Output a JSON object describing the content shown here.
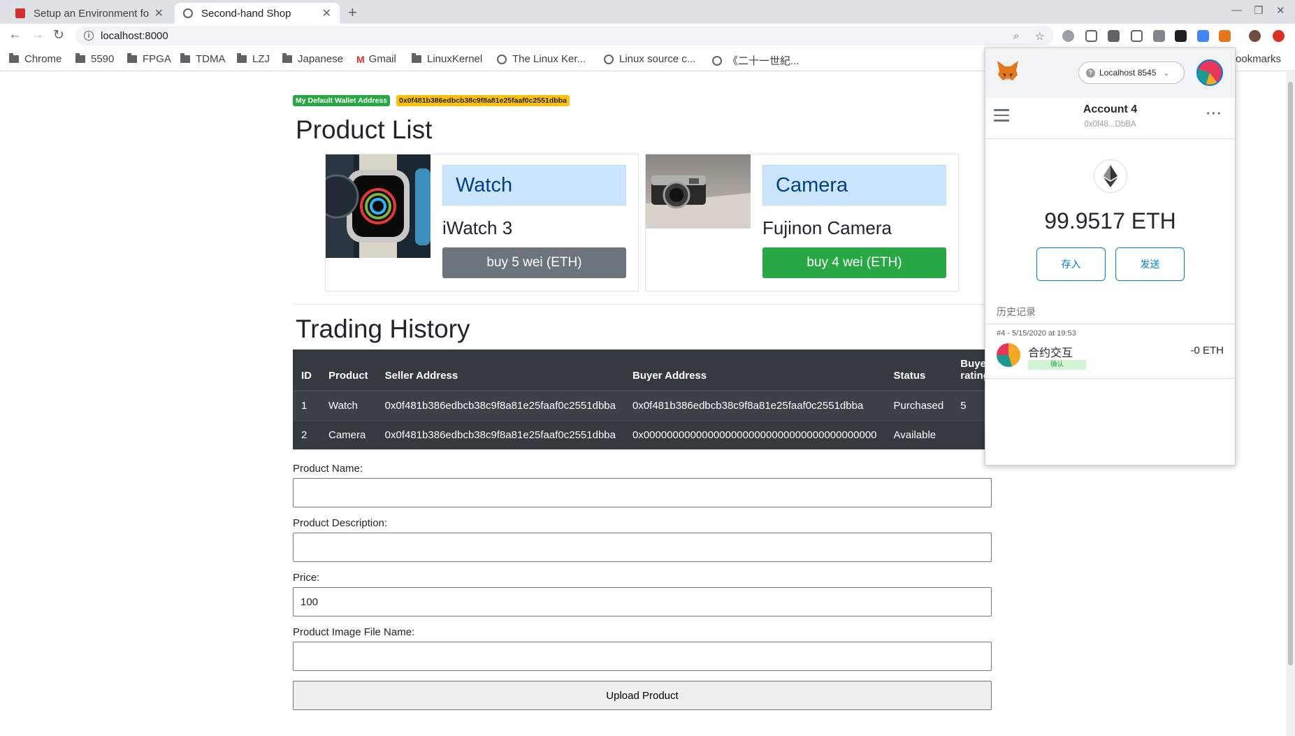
{
  "browser": {
    "tabs": [
      {
        "title": "Setup an Environment fo"
      },
      {
        "title": "Second-hand Shop"
      }
    ],
    "url": "localhost:8000",
    "bookmarks": [
      {
        "label": "Chrome",
        "icon": "folder-icon"
      },
      {
        "label": "5590",
        "icon": "folder-icon"
      },
      {
        "label": "FPGA",
        "icon": "folder-icon"
      },
      {
        "label": "TDMA",
        "icon": "folder-icon"
      },
      {
        "label": "LZJ",
        "icon": "folder-icon"
      },
      {
        "label": "Japanese",
        "icon": "folder-icon"
      },
      {
        "label": "Gmail",
        "icon": "gmail-icon"
      },
      {
        "label": "LinuxKernel",
        "icon": "folder-icon"
      },
      {
        "label": "The Linux Ker...",
        "icon": "globe-icon"
      },
      {
        "label": "Linux source c...",
        "icon": "globe-icon"
      },
      {
        "label": "《二十一世紀...",
        "icon": "globe-icon"
      },
      {
        "label": "ookmarks",
        "icon": "none"
      }
    ]
  },
  "page": {
    "wallet_badge": "My Default Wallet Address",
    "wallet_address": "0x0f481b386edbcb38c9f8a81e25faaf0c2551dbba",
    "product_list_title": "Product List",
    "products": [
      {
        "category": "Watch",
        "name": "iWatch 3",
        "buy_label": "buy 5 wei (ETH)"
      },
      {
        "category": "Camera",
        "name": "Fujinon Camera",
        "buy_label": "buy 4 wei (ETH)"
      }
    ],
    "trading_history_title": "Trading History",
    "table": {
      "headers": [
        "ID",
        "Product",
        "Seller Address",
        "Buyer Address",
        "Status",
        "Buyer's rating"
      ],
      "rows": [
        [
          "1",
          "Watch",
          "0x0f481b386edbcb38c9f8a81e25faaf0c2551dbba",
          "0x0f481b386edbcb38c9f8a81e25faaf0c2551dbba",
          "Purchased",
          "5"
        ],
        [
          "2",
          "Camera",
          "0x0f481b386edbcb38c9f8a81e25faaf0c2551dbba",
          "0x0000000000000000000000000000000000000000",
          "Available",
          ""
        ]
      ]
    },
    "form": {
      "name_label": "Product Name:",
      "name_value": "",
      "desc_label": "Product Description:",
      "desc_value": "",
      "price_label": "Price:",
      "price_value": "100",
      "image_label": "Product Image File Name:",
      "image_value": "",
      "upload_label": "Upload Product"
    }
  },
  "metamask": {
    "network": "Localhost 8545",
    "account_name": "Account 4",
    "account_address": "0x0f48...DbBA",
    "balance": "99.9517",
    "currency": "ETH",
    "deposit_label": "存入",
    "send_label": "发送",
    "history_label": "历史记录",
    "tx": {
      "meta": "#4 - 5/15/2020 at 19:53",
      "name": "合约交互",
      "status": "确认",
      "amount": "-0 ETH"
    }
  }
}
